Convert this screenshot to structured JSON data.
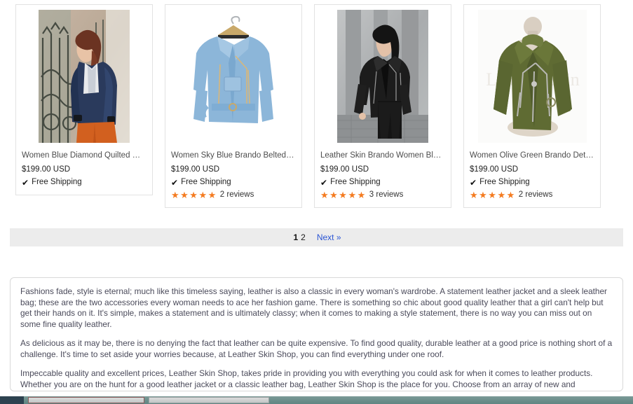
{
  "products": [
    {
      "title": "Women Blue Diamond Quilted Gen...",
      "price": "$199.00 USD",
      "shipping": "Free Shipping",
      "shipping_icon": "check-icon",
      "reviews": null,
      "stars": null,
      "image_alt": "Woman wearing navy blue quilted leather jacket in front of iron gate"
    },
    {
      "title": "Women Sky Blue Brando Belted L...",
      "price": "$199.00 USD",
      "shipping": "Free Shipping",
      "shipping_icon": "check-icon",
      "reviews": "2 reviews",
      "stars": "★★★★★",
      "image_alt": "Sky blue belted brando leather jacket on a hanger"
    },
    {
      "title": "Leather Skin Brando Women Blac...",
      "price": "$199.00 USD",
      "shipping": "Free Shipping",
      "shipping_icon": "check-icon",
      "reviews": "3 reviews",
      "stars": "★★★★★",
      "image_alt": "Model in black brando leather jacket and black jeans"
    },
    {
      "title": "Women Olive Green Brando Detac...",
      "price": "$199.00 USD",
      "shipping": "Free Shipping",
      "shipping_icon": "check-icon",
      "reviews": "2 reviews",
      "stars": "★★★★★",
      "image_alt": "Olive green detachable hood brando jacket on mannequin"
    }
  ],
  "pagination": {
    "current_page": "1",
    "page_2": "2",
    "next_label": "Next »"
  },
  "description": {
    "paragraph_1": "Fashions fade, style is eternal; much like this timeless saying, leather is also a classic in every woman's wardrobe. A statement leather jacket and a sleek leather bag; these are the two accessories every woman needs to ace her fashion game. There is something so chic about good quality leather that a girl can't help but get their hands on it. It's simple, makes a statement and is ultimately classy; when it comes to making a style statement, there is no way you can miss out on some fine quality leather.",
    "paragraph_2": "As delicious as it may be, there is no denying the fact that leather can be quite expensive. To find good quality, durable leather at a good price is nothing short of a challenge. It's time to set aside your worries because, at Leather Skin Shop, you can find everything under one roof.",
    "paragraph_3": "Impeccable quality and excellent prices, Leather Skin Shop, takes pride in providing you with everything you could ask for when it comes to leather products. Whether you are on the hunt for a good leather jacket or a classic leather bag, Leather Skin Shop is the place for you. Choose from an array of new and deliciously unique designs and hues to find your favorite."
  },
  "colors": {
    "star_orange": "#f47b20",
    "next_link_blue": "#2b55d4",
    "pagination_bg": "#ececec",
    "card_border": "#e2e2e2",
    "body_text": "#4a4a5a"
  }
}
